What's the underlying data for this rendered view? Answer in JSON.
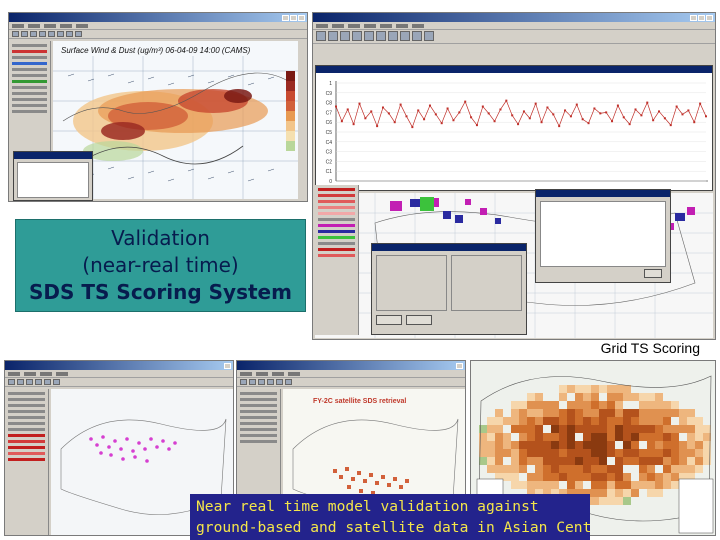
{
  "slide": {
    "callout_lines": [
      "Validation",
      "(near-real time)",
      "SDS TS Scoring System"
    ],
    "grid_label": "Grid TS Scoring",
    "banner_lines": [
      "Near real time model validation against",
      "ground-based and satellite data in Asian Centre"
    ]
  },
  "screenshots": {
    "wind_dust_map": {
      "map_title": "Surface Wind & Dust (ug/m³)  06-04-09 14:00 (CAMS)"
    },
    "satellite_map": {
      "map_title": "FY-2C satellite SDS retrieval"
    }
  },
  "chart_data": {
    "type": "line",
    "title": "",
    "xlabel": "",
    "ylabel": "",
    "ylim": [
      0,
      10
    ],
    "yticks": [
      "0",
      "C1",
      "C2",
      "C3",
      "C4",
      "C5",
      "C6",
      "C7",
      "C8",
      "C9",
      "1"
    ],
    "series": [
      {
        "values": [
          7.6,
          6.1,
          7.3,
          5.8,
          7.9,
          6.4,
          7.1,
          5.6,
          7.5,
          6.9,
          6.0,
          7.8,
          6.6,
          5.5,
          7.2,
          6.3,
          7.7,
          6.8,
          5.9,
          7.4,
          6.2,
          7.0,
          8.1,
          6.5,
          5.7,
          7.6,
          6.9,
          6.1,
          7.3,
          8.2,
          6.7,
          5.8,
          7.1,
          6.4,
          7.9,
          6.0,
          7.5,
          6.8,
          5.6,
          7.2,
          6.6,
          7.8,
          6.3,
          5.9,
          7.4,
          6.9,
          7.0,
          6.1,
          7.7,
          6.5,
          5.8,
          7.3,
          6.7,
          8.0,
          6.2,
          7.1,
          6.4,
          5.7,
          7.6,
          6.8,
          7.2,
          6.0,
          7.9,
          6.6
        ]
      }
    ]
  }
}
